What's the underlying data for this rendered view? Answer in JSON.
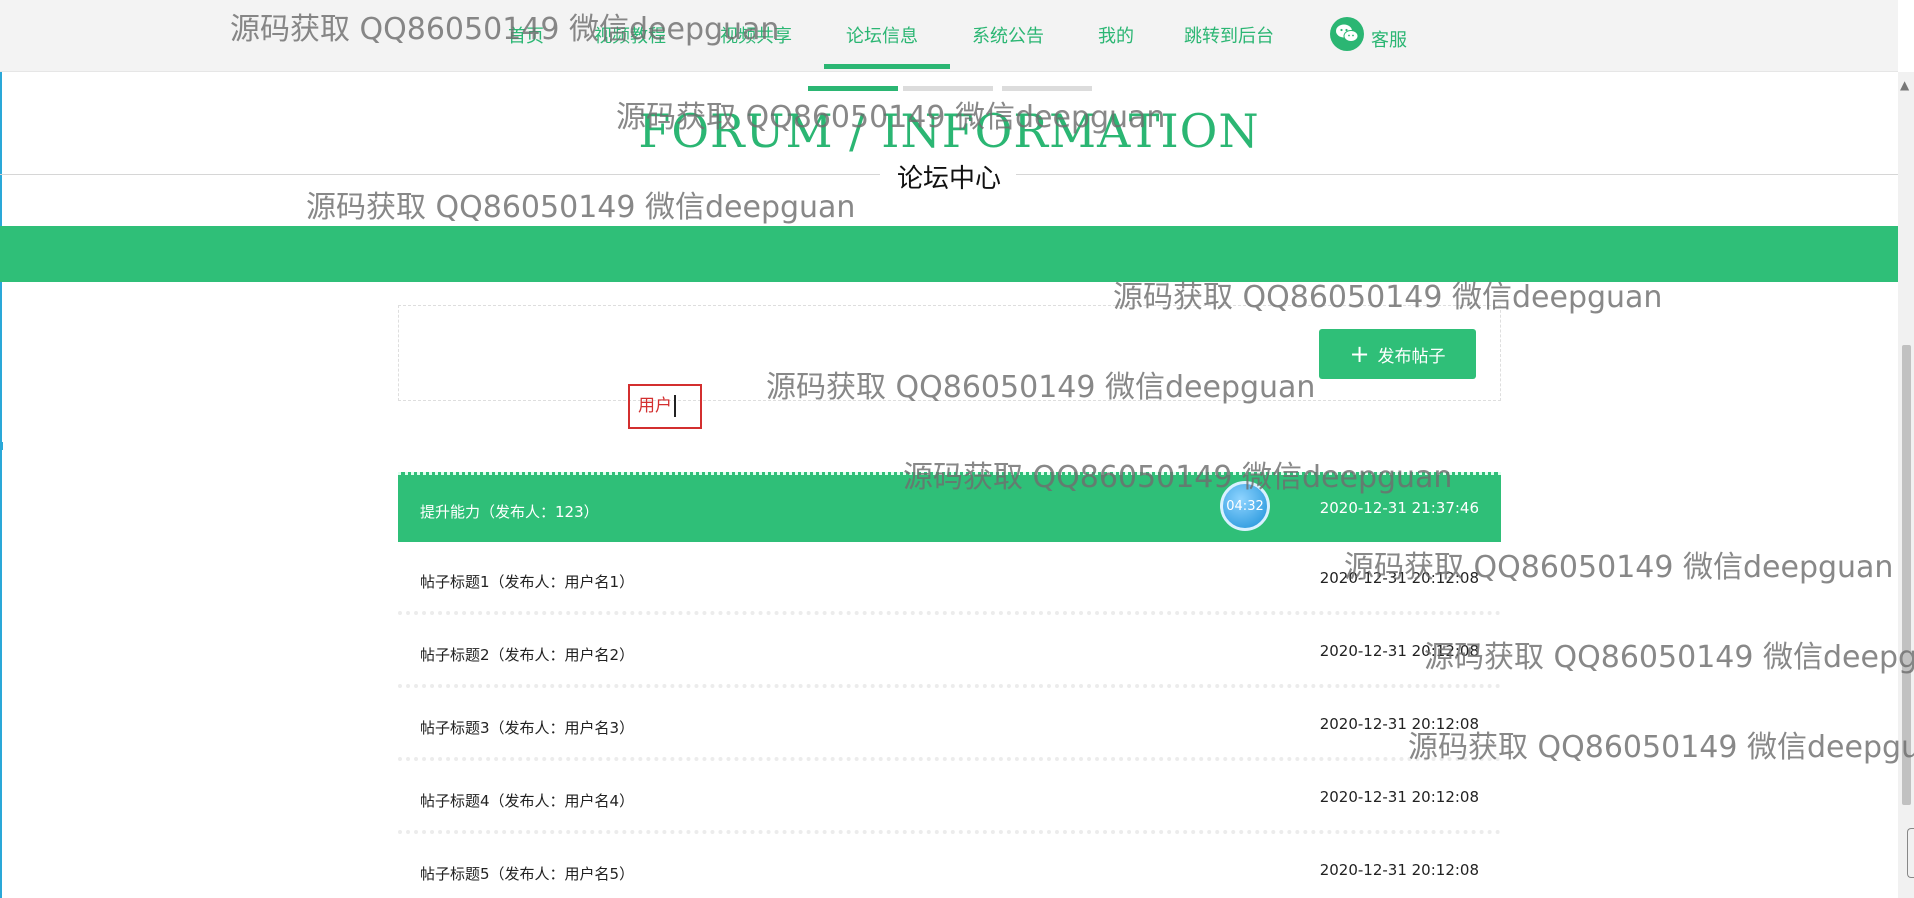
{
  "nav": {
    "items": [
      {
        "label": "首页"
      },
      {
        "label": "视频教程"
      },
      {
        "label": "视频共享"
      },
      {
        "label": "论坛信息",
        "active": true
      },
      {
        "label": "系统公告"
      },
      {
        "label": "我的"
      },
      {
        "label": "跳转到后台"
      },
      {
        "label": "客服",
        "icon": "wechat-icon"
      }
    ]
  },
  "heading": {
    "title": "FORUM / INFORMATION",
    "subtitle": "论坛中心"
  },
  "search": {
    "field_value": "用户",
    "publish_label": "发布帖子",
    "publish_icon": "plus-icon"
  },
  "timer": "04:32",
  "posts": [
    {
      "title": "提升能力（发布人：123）",
      "date": "2020-12-31 21:37:46",
      "active": true
    },
    {
      "title": "帖子标题1（发布人：用户名1）",
      "date": "2020-12-31 20:12:08"
    },
    {
      "title": "帖子标题2（发布人：用户名2）",
      "date": "2020-12-31 20:12:08"
    },
    {
      "title": "帖子标题3（发布人：用户名3）",
      "date": "2020-12-31 20:12:08"
    },
    {
      "title": "帖子标题4（发布人：用户名4）",
      "date": "2020-12-31 20:12:08"
    },
    {
      "title": "帖子标题5（发布人：用户名5）",
      "date": "2020-12-31 20:12:08"
    }
  ],
  "watermark_text": "源码获取 QQ86050149 微信deepguan",
  "colors": {
    "accent": "#2bb673",
    "banner": "#2fbf78",
    "highlight_border": "#d32f2f"
  }
}
